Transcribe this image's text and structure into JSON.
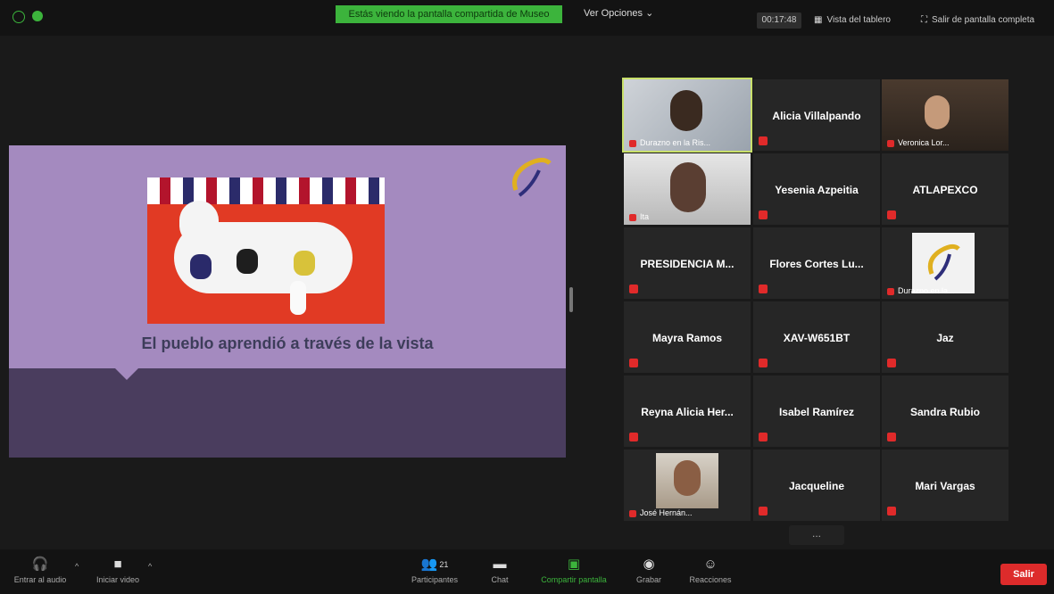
{
  "topbar": {
    "share_banner": "Estás viendo la pantalla compartida de Museo",
    "view_options": "Ver Opciones ⌄",
    "timer": "00:17:48",
    "tile_view_label": "Vista del tablero",
    "fullscreen_label": "Salir de pantalla completa"
  },
  "slide": {
    "caption": "El pueblo aprendió a través de la vista"
  },
  "participants": [
    {
      "name": "Durazno en la Ris...",
      "video": true
    },
    {
      "name": "Alicia Villalpando",
      "video": false
    },
    {
      "name": "Veronica Lor...",
      "video": true
    },
    {
      "name": "Ita",
      "video": true
    },
    {
      "name": "Yesenia Azpeitia",
      "video": false
    },
    {
      "name": "ATLAPEXCO",
      "video": false
    },
    {
      "name": "PRESIDENCIA M...",
      "video": false
    },
    {
      "name": "Flores Cortes Lu...",
      "video": false
    },
    {
      "name": "Durazno en la...",
      "video": true
    },
    {
      "name": "Mayra Ramos",
      "video": false
    },
    {
      "name": "XAV-W651BT",
      "video": false
    },
    {
      "name": "Jaz",
      "video": false
    },
    {
      "name": "Reyna Alicia Her...",
      "video": false
    },
    {
      "name": "Isabel Ramírez",
      "video": false
    },
    {
      "name": "Sandra Rubio",
      "video": false
    },
    {
      "name": "José Hernán...",
      "video": true
    },
    {
      "name": "Jacqueline",
      "video": false
    },
    {
      "name": "Mari Vargas",
      "video": false
    }
  ],
  "more_button": "...",
  "bottombar": {
    "audio_label": "Entrar al audio",
    "video_label": "Iniciar video",
    "participants_label": "Participantes",
    "participants_count": "21",
    "chat_label": "Chat",
    "share_label": "Compartir pantalla",
    "record_label": "Grabar",
    "reactions_label": "Reacciones",
    "leave_label": "Salir"
  },
  "colors": {
    "accent_green": "#3cb43c",
    "leave_red": "#dd2b2b",
    "mute_red": "#e02a2a",
    "slide_purple": "#a48abf",
    "active_speaker": "#c9e06b"
  }
}
